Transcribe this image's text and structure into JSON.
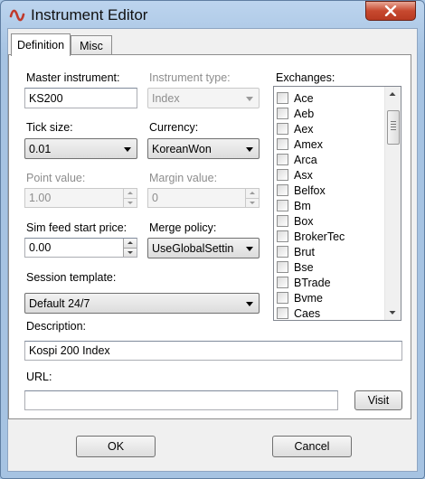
{
  "window": {
    "title": "Instrument Editor"
  },
  "tabs": [
    {
      "label": "Definition"
    },
    {
      "label": "Misc"
    }
  ],
  "form": {
    "master_instrument": {
      "label": "Master instrument:",
      "value": "KS200"
    },
    "instrument_type": {
      "label": "Instrument type:",
      "value": "Index"
    },
    "tick_size": {
      "label": "Tick size:",
      "value": "0.01"
    },
    "currency": {
      "label": "Currency:",
      "value": "KoreanWon"
    },
    "point_value": {
      "label": "Point value:",
      "value": "1.00"
    },
    "margin_value": {
      "label": "Margin value:",
      "value": "0"
    },
    "sim_feed_start_price": {
      "label": "Sim feed start price:",
      "value": "0.00"
    },
    "merge_policy": {
      "label": "Merge policy:",
      "value": "UseGlobalSettin"
    },
    "session_template": {
      "label": "Session template:",
      "value": "Default 24/7"
    },
    "description": {
      "label": "Description:",
      "value": "Kospi 200 Index"
    },
    "url": {
      "label": "URL:",
      "value": ""
    }
  },
  "exchanges": {
    "label": "Exchanges:",
    "items": [
      "Ace",
      "Aeb",
      "Aex",
      "Amex",
      "Arca",
      "Asx",
      "Belfox",
      "Bm",
      "Box",
      "BrokerTec",
      "Brut",
      "Bse",
      "BTrade",
      "Bvme",
      "Caes"
    ]
  },
  "buttons": {
    "visit": "Visit",
    "ok": "OK",
    "cancel": "Cancel"
  },
  "colors": {
    "close_button": "#c7492f",
    "title_bar": "#a9c7e6",
    "logo_red": "#c0392b"
  }
}
